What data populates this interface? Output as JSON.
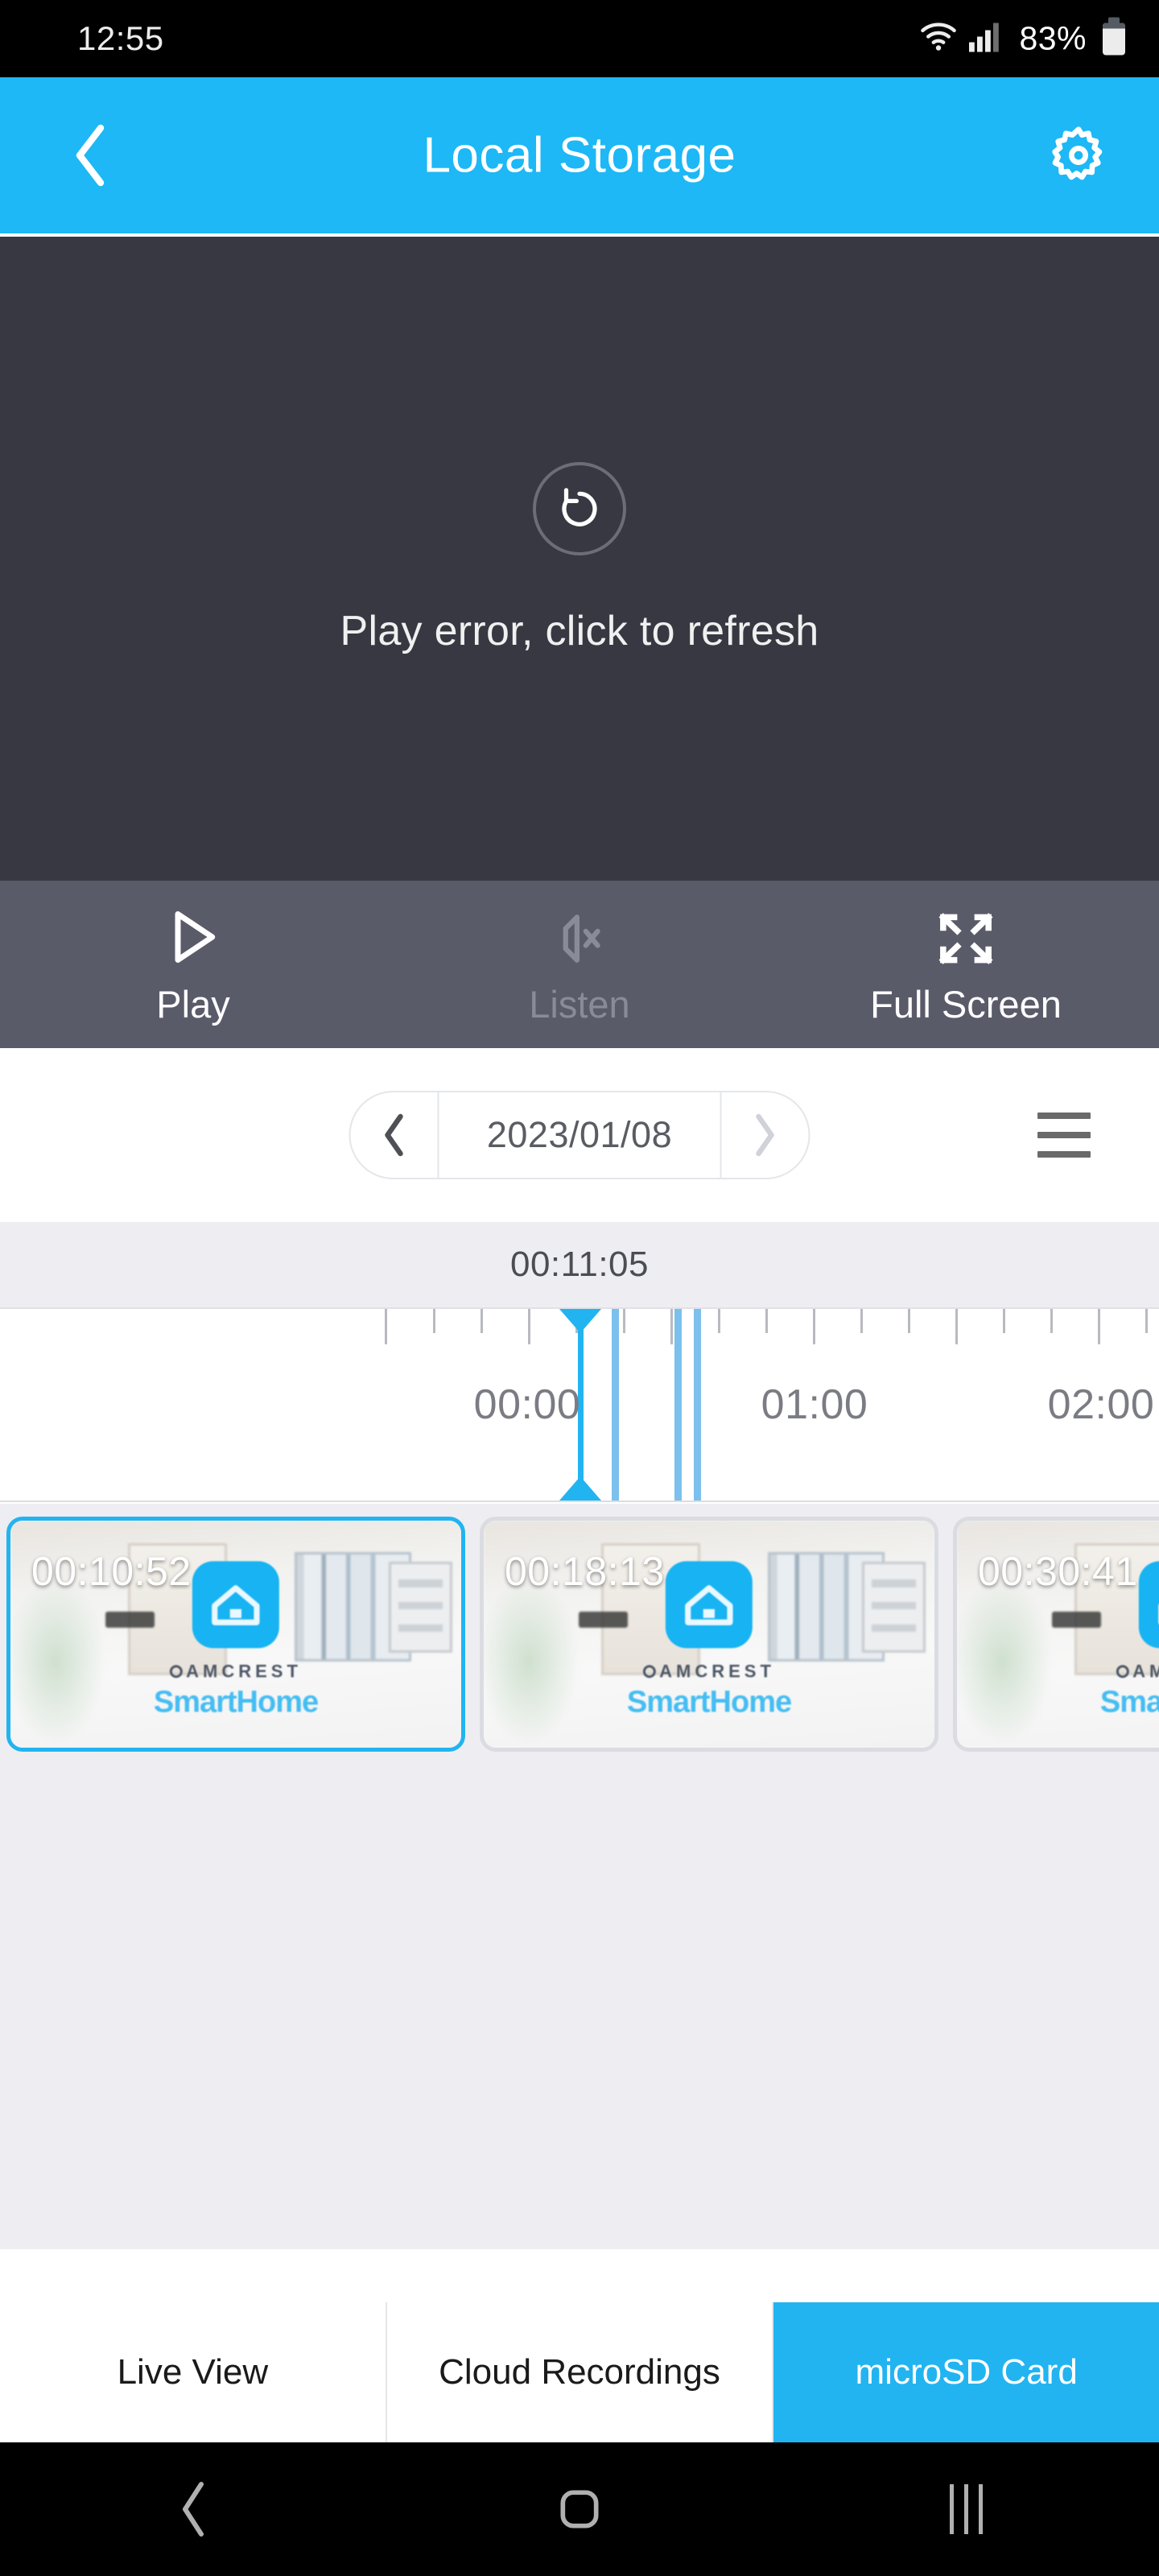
{
  "status_bar": {
    "time": "12:55",
    "battery_percent": "83%",
    "icons": [
      "wifi-icon",
      "cellular-signal-icon",
      "battery-icon"
    ]
  },
  "header": {
    "title": "Local Storage",
    "back_icon": "chevron-left-icon",
    "settings_icon": "gear-icon",
    "background_color": "#1db8f5"
  },
  "video_player": {
    "error_message": "Play error, click to refresh",
    "refresh_icon": "refresh-rotate-icon",
    "background_color": "#383842"
  },
  "controls": [
    {
      "label": "Play",
      "icon": "play-triangle-icon",
      "enabled": true
    },
    {
      "label": "Listen",
      "icon": "speaker-muted-icon",
      "enabled": false
    },
    {
      "label": "Full Screen",
      "icon": "expand-arrows-icon",
      "enabled": true
    }
  ],
  "date_picker": {
    "date": "2023/01/08",
    "prev_icon": "chevron-left-icon",
    "next_icon": "chevron-right-icon",
    "list_icon": "hamburger-menu-icon"
  },
  "timeline": {
    "current_time": "00:11:05",
    "hour_labels": [
      "00:00",
      "01:00",
      "02:00"
    ],
    "playhead_time": "00:11:05",
    "accent_color": "#22b4f0",
    "event_color": "#7cc0ee"
  },
  "clips": [
    {
      "time": "00:10:52",
      "selected": true,
      "brand": "AMCREST",
      "product": "SmartHome"
    },
    {
      "time": "00:18:13",
      "selected": false,
      "brand": "AMCREST",
      "product": "SmartHome"
    },
    {
      "time": "00:30:41",
      "selected": false,
      "brand": "AMCREST",
      "product": "SmartHome"
    }
  ],
  "tabs": [
    {
      "label": "Live View",
      "active": false
    },
    {
      "label": "Cloud Recordings",
      "active": false
    },
    {
      "label": "microSD Card",
      "active": true
    }
  ],
  "nav_bar": {
    "back_icon": "chevron-left-icon",
    "home_icon": "home-square-icon",
    "recents_icon": "recents-bars-icon"
  }
}
